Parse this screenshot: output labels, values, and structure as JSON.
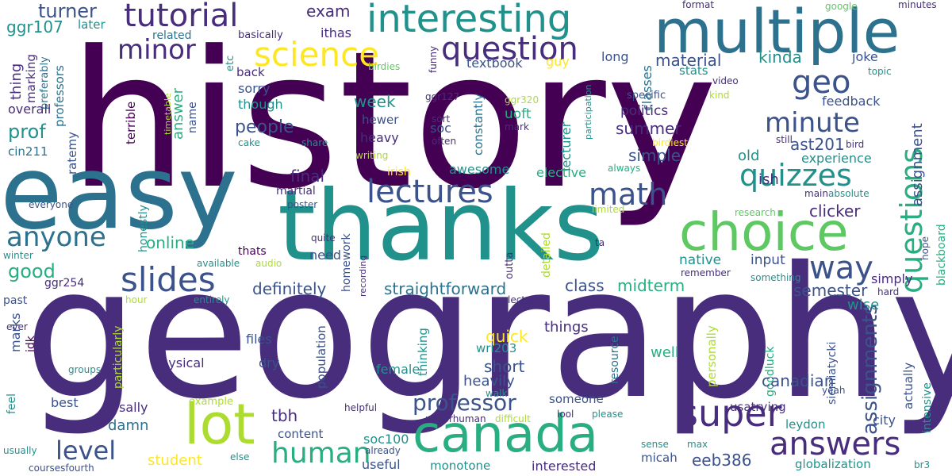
{
  "colors": {
    "dark_purple": "#440154",
    "indigo": "#472d7b",
    "blue_violet": "#3b528b",
    "steel_blue": "#2c728e",
    "teal": "#21918c",
    "sea_green": "#28ae80",
    "green": "#5ec962",
    "lime": "#addc30",
    "yellow": "#fde725"
  },
  "words": {
    "history": "history",
    "geography": "geography",
    "easy": "easy",
    "thanks": "thanks",
    "multiple": "multiple",
    "choice": "choice",
    "canada": "canada",
    "lot": "lot",
    "interesting": "interesting",
    "tutorial": "tutorial",
    "science": "science",
    "question": "question",
    "minor": "minor",
    "lectures": "lectures",
    "math": "math",
    "quizzes": "quizzes",
    "questions": "questions",
    "slides": "slides",
    "anyone": "anyone",
    "way": "way",
    "super": "super",
    "answers": "answers",
    "human": "human",
    "level": "level",
    "professor": "professor",
    "geo": "geo",
    "minute": "minute",
    "assignments": "assignments",
    "turner": "turner",
    "exam": "exam",
    "ggr107": "ggr107",
    "later": "later",
    "related": "related",
    "basically": "basically",
    "ithas": "ithas",
    "thing": "thing",
    "marking": "marking",
    "preferably": "preferably",
    "professors": "professors",
    "overall": "overall",
    "ratemy": "ratemy",
    "answer": "answer",
    "name": "name",
    "etc": "etc",
    "back": "back",
    "sorry": "sorry",
    "though": "though",
    "week": "week",
    "material": "material",
    "kinda": "kinda",
    "textbook": "textbook",
    "guy": "guy",
    "long": "long",
    "classes": "classes",
    "joke": "joke",
    "topic": "topic",
    "format": "format",
    "google": "google",
    "minutes": "minutes",
    "birdies": "birdies",
    "funny": "funny",
    "participation": "participation",
    "lecturer": "lecturer",
    "stats": "stats",
    "video": "video",
    "kind": "kind",
    "specific": "specific",
    "politics": "politics",
    "ggr127": "ggr127",
    "ggr320": "ggr320",
    "uoft": "uoft",
    "hewer": "hewer",
    "soc": "soc",
    "sort": "sort",
    "mark": "mark",
    "often": "often",
    "constantly": "constantly",
    "timetable": "timetable",
    "feedback": "feedback",
    "summer": "summer",
    "ast201": "ast201",
    "old": "old",
    "experience": "experience",
    "still": "still",
    "bird": "bird",
    "birdiest": "birdiest",
    "always": "always",
    "assignment": "assignment",
    "prof": "prof",
    "cin211": "cin211",
    "terrible": "terrible",
    "people": "people",
    "heavy": "heavy",
    "writing": "writing",
    "cake": "cake",
    "share": "share",
    "simple": "simple",
    "final": "final",
    "martial": "martial",
    "awesome": "awesome",
    "elective": "elective",
    "irish": "irish",
    "ish": "ish",
    "main": "main",
    "absolute": "absolute",
    "everyone": "everyone",
    "honestly": "honestly",
    "poster": "poster",
    "limited": "limited",
    "research": "research",
    "clicker": "clicker",
    "online": "online",
    "thats": "thats",
    "homework": "homework",
    "outta": "outta",
    "detailed": "detailed",
    "quite": "quite",
    "ta": "ta",
    "native": "native",
    "input": "input",
    "hope": "hope",
    "blackboard": "blackboard",
    "winter": "winter",
    "good": "good",
    "available": "available",
    "audio": "audio",
    "need": "need",
    "recording": "recording",
    "remember": "remember",
    "something": "something",
    "ggr254": "ggr254",
    "definitely": "definitely",
    "straightforward": "straightforward",
    "class": "class",
    "midterm": "midterm",
    "semester": "semester",
    "simply": "simply",
    "past": "past",
    "hour": "hour",
    "entirely": "entirely",
    "lecture": "lecture",
    "burn": "burn",
    "hard": "hard",
    "wise": "wise",
    "marks": "marks",
    "particularly": "particularly",
    "quick": "quick",
    "things": "things",
    "personally": "personally",
    "ever": "ever",
    "idk": "idk",
    "files": "files",
    "population": "population",
    "thinking": "thinking",
    "wri203": "wri203",
    "resource": "resource",
    "well": "well",
    "siemiatycki": "siemiatycki",
    "physical": "physical",
    "dry": "dry",
    "short": "short",
    "female": "female",
    "heavily": "heavily",
    "goodluck": "goodluck",
    "actually": "actually",
    "intensive": "intensive",
    "groups": "groups",
    "feel": "feel",
    "best": "best",
    "sally": "sally",
    "example": "example",
    "someone": "someone",
    "walk": "walk",
    "yeah": "yeah",
    "usatrying": "usatrying",
    "damn": "damn",
    "tbh": "tbh",
    "helpful": "helpful",
    "minorhuman": "minorhuman",
    "difficult": "difficult",
    "lool": "lool",
    "please": "please",
    "leydon": "leydon",
    "city": "city",
    "canadian": "canadian",
    "content": "content",
    "student": "student",
    "soc100": "soc100",
    "eeb386": "eeb386",
    "micah": "micah",
    "sense": "sense",
    "max": "max",
    "usually": "usually",
    "else": "else",
    "already": "already",
    "useful": "useful",
    "monotone": "monotone",
    "interested": "interested",
    "globalization": "globalization",
    "coursesfourth": "coursesfourth",
    "br3": "br3"
  }
}
